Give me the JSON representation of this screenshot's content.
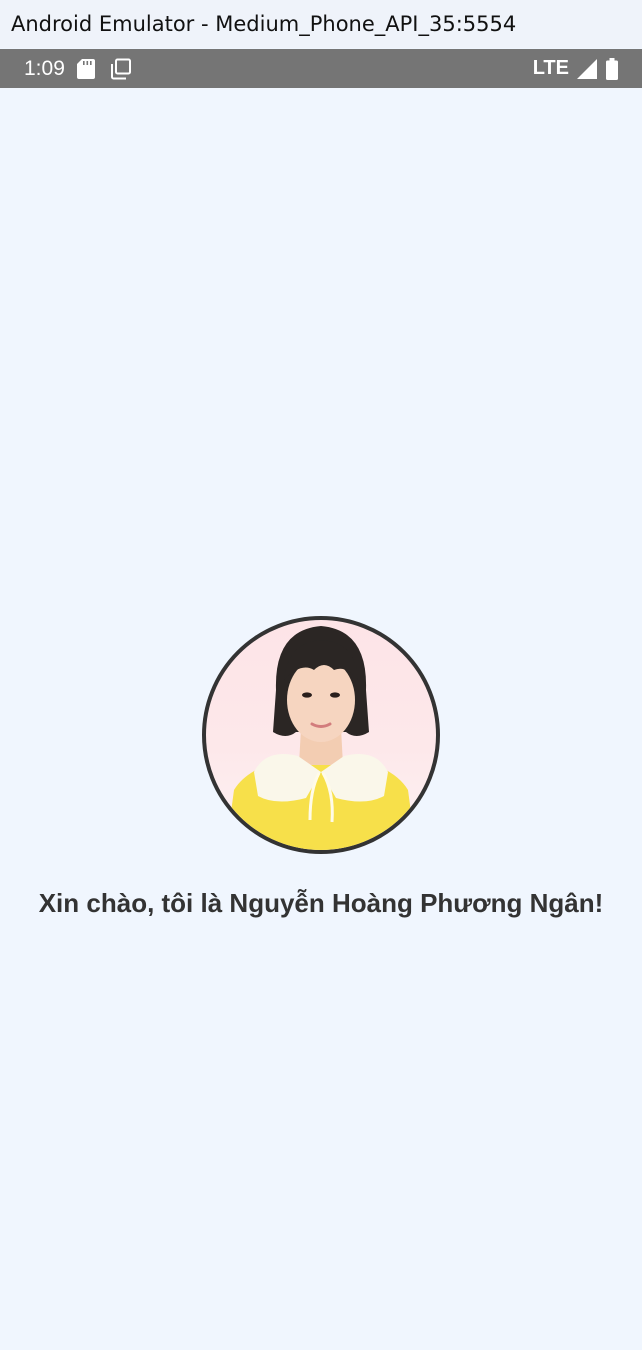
{
  "window": {
    "title": "Android Emulator - Medium_Phone_API_35:5554"
  },
  "status_bar": {
    "time": "1:09",
    "network": "LTE",
    "icons": [
      "sd-card-icon",
      "copy-icon",
      "signal-icon",
      "battery-icon"
    ]
  },
  "main": {
    "greeting": "Xin chào, tôi là Nguyễn Hoàng Phương Ngân!",
    "avatar": "profile-photo"
  },
  "colors": {
    "background": "#f0f6fe",
    "status_bar": "#757575",
    "text": "#333333"
  }
}
